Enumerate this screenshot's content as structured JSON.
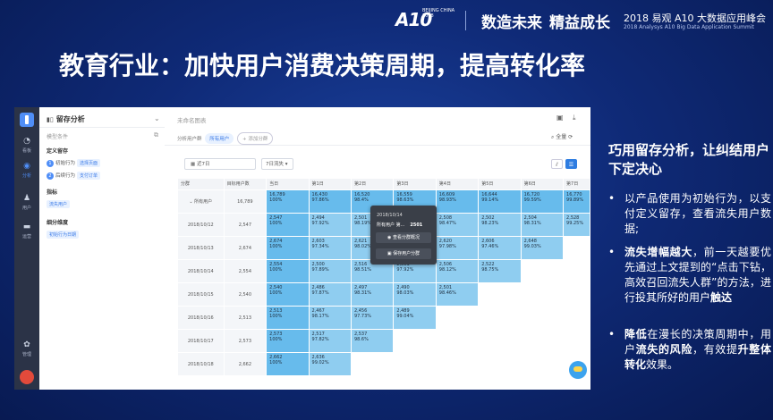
{
  "header": {
    "logo_mark": "A10",
    "logo_sub": "BEIJING CHINA 2018",
    "slogan1": "数造未来",
    "slogan2": "精益成长",
    "summit_cn": "2018 易观 A10 大数据应用峰会",
    "summit_en": "2018 Analysys A10 Big Data Application Summit"
  },
  "slide_title": "教育行业：加快用户消费决策周期，提高转化率",
  "app": {
    "rail": {
      "items": [
        {
          "label": "看板",
          "icon": "dashboard-icon",
          "glyph": "◔"
        },
        {
          "label": "分析",
          "icon": "analysis-icon",
          "glyph": "◉"
        },
        {
          "label": "用户",
          "icon": "user-icon",
          "glyph": "♟"
        },
        {
          "label": "运营",
          "icon": "campaign-icon",
          "glyph": "▬"
        },
        {
          "label": "管理",
          "icon": "gear-icon",
          "glyph": "✿"
        }
      ]
    },
    "panel": {
      "title": "留存分析",
      "template_label": "模型条件",
      "define_label": "定义留存",
      "initial_prefix": "初始行为",
      "initial_tag": "选择页面",
      "return_prefix": "后续行为",
      "return_tag": "支付订单",
      "metric_label": "指标",
      "metric_tag": "流失用户",
      "dim_label": "细分维度",
      "dim_tag": "初始行为日期"
    },
    "main": {
      "chart_name": "未命名图表",
      "filter_label": "分析用户群",
      "filter_selected": "所有用户",
      "filter_add": "+ 添加分群",
      "full_label": "全量",
      "date_range": "近7日",
      "granularity": "7日流失",
      "table": {
        "headers": [
          "分群",
          "目标用户数",
          "当日",
          "第1日",
          "第2日",
          "第3日",
          "第4日",
          "第5日",
          "第6日",
          "第7日"
        ],
        "rows": [
          {
            "label": "所有用户",
            "users": "16,789",
            "cells": [
              [
                "16,789",
                "100%"
              ],
              [
                "16,430",
                "97.86%"
              ],
              [
                "16,520",
                "98.4%"
              ],
              [
                "16,559",
                "98.63%"
              ],
              [
                "16,609",
                "98.93%"
              ],
              [
                "16,644",
                "99.14%"
              ],
              [
                "16,720",
                "99.59%"
              ],
              [
                "16,770",
                "99.89%"
              ]
            ]
          },
          {
            "label": "2018/10/12",
            "users": "2,547",
            "cells": [
              [
                "2,547",
                "100%"
              ],
              [
                "2,494",
                "97.92%"
              ],
              [
                "2,501",
                "98.19%"
              ],
              [
                "2,511",
                "98.59%"
              ],
              [
                "2,508",
                "98.47%"
              ],
              [
                "2,502",
                "98.23%"
              ],
              [
                "2,504",
                "98.31%"
              ],
              [
                "2,528",
                "99.25%"
              ]
            ]
          },
          {
            "label": "2018/10/13",
            "users": "2,674",
            "cells": [
              [
                "2,674",
                "100%"
              ],
              [
                "2,603",
                "97.34%"
              ],
              [
                "2,621",
                "98.02%"
              ],
              [
                "2,629",
                "98.31%"
              ],
              [
                "2,620",
                "97.98%"
              ],
              [
                "2,606",
                "97.46%"
              ],
              [
                "2,648",
                "99.03%"
              ]
            ]
          },
          {
            "label": "2018/10/14",
            "users": "2,554",
            "cells": [
              [
                "2,554",
                "100%"
              ],
              [
                "2,500",
                "97.89%"
              ],
              [
                "2,516",
                "98.51%"
              ],
              [
                "2,501",
                "97.92%"
              ],
              [
                "2,506",
                "98.12%"
              ],
              [
                "2,522",
                "98.75%"
              ]
            ]
          },
          {
            "label": "2018/10/15",
            "users": "2,540",
            "cells": [
              [
                "2,540",
                "100%"
              ],
              [
                "2,486",
                "97.87%"
              ],
              [
                "2,497",
                "98.31%"
              ],
              [
                "2,490",
                "98.03%"
              ],
              [
                "2,501",
                "98.46%"
              ]
            ]
          },
          {
            "label": "2018/10/16",
            "users": "2,513",
            "cells": [
              [
                "2,513",
                "100%"
              ],
              [
                "2,467",
                "98.17%"
              ],
              [
                "2,456",
                "97.73%"
              ],
              [
                "2,489",
                "99.04%"
              ]
            ]
          },
          {
            "label": "2018/10/17",
            "users": "2,573",
            "cells": [
              [
                "2,573",
                "100%"
              ],
              [
                "2,517",
                "97.82%"
              ],
              [
                "2,537",
                "98.6%"
              ]
            ]
          },
          {
            "label": "2018/10/18",
            "users": "2,662",
            "cells": [
              [
                "2,662",
                "100%"
              ],
              [
                "2,636",
                "99.02%"
              ]
            ]
          }
        ]
      },
      "tooltip": {
        "date": "2018/10/14",
        "users_label": "所有用户  第...",
        "users_value": "2501",
        "btn_view": "查看分群概况",
        "btn_save": "保存用户分群"
      }
    }
  },
  "side": {
    "title": "巧用留存分析，让纠结用户下定决心",
    "bullet1": "以产品使用为初始行为，以支付定义留存，查看流失用户数据;",
    "bullet2_bold": "流失增幅越大",
    "bullet2_rest": "，前一天越要优先通过上文提到的“点击下钻，高效召回流失人群”的方法，进行投其所好的用户",
    "bullet2_tail": "触达",
    "bullet3_bold1": "降低",
    "bullet3_mid1": "在漫长的决策周期中，用户",
    "bullet3_bold2": "流失的风险",
    "bullet3_mid2": "，有效提",
    "bullet3_bold3": "升整体转化",
    "bullet3_end": "效果。"
  }
}
